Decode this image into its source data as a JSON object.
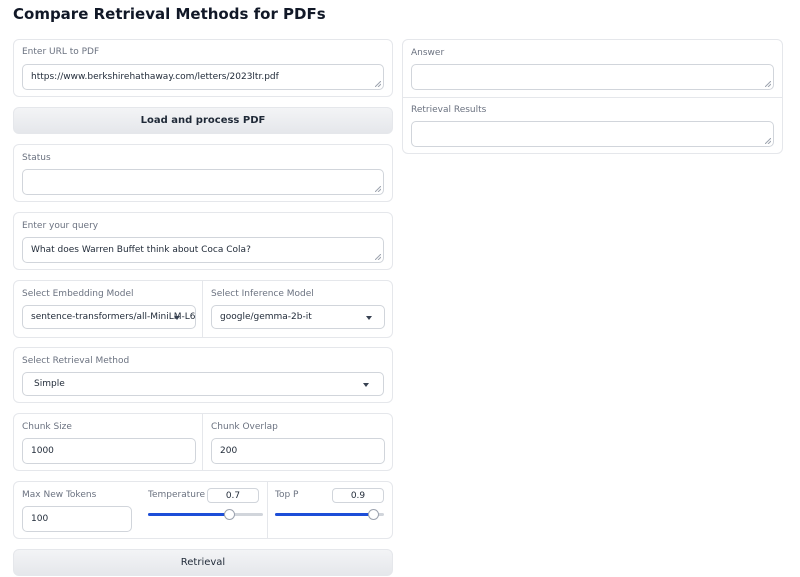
{
  "page": {
    "title": "Compare Retrieval Methods for PDFs"
  },
  "url_block": {
    "label": "Enter URL to PDF",
    "value": "https://www.berkshirehathaway.com/letters/2023ltr.pdf"
  },
  "load_button": {
    "label": "Load and process PDF"
  },
  "status_block": {
    "label": "Status",
    "value": ""
  },
  "query_block": {
    "label": "Enter your query",
    "value": "What does Warren Buffet think about Coca Cola?"
  },
  "models": {
    "embedding_label": "Select Embedding Model",
    "embedding_value": "sentence-transformers/all-MiniLM-L6",
    "inference_label": "Select Inference Model",
    "inference_value": "google/gemma-2b-it"
  },
  "retrieval_method": {
    "label": "Select Retrieval Method",
    "value": "Simple"
  },
  "chunking": {
    "size_label": "Chunk Size",
    "size_value": "1000",
    "overlap_label": "Chunk Overlap",
    "overlap_value": "200"
  },
  "generation": {
    "max_tokens_label": "Max New Tokens",
    "max_tokens_value": "100",
    "temperature_label": "Temperature",
    "temperature_value": "0.7",
    "temperature_fraction": 0.7,
    "top_p_label": "Top P",
    "top_p_value": "0.9",
    "top_p_fraction": 0.9
  },
  "retrieval_button": {
    "label": "Retrieval"
  },
  "answer_block": {
    "label": "Answer",
    "value": ""
  },
  "results_block": {
    "label": "Retrieval Results",
    "value": ""
  },
  "colors": {
    "slider_accent": "#1d4ed8",
    "border": "#e5e7eb",
    "button_bg": "#eceef1"
  }
}
